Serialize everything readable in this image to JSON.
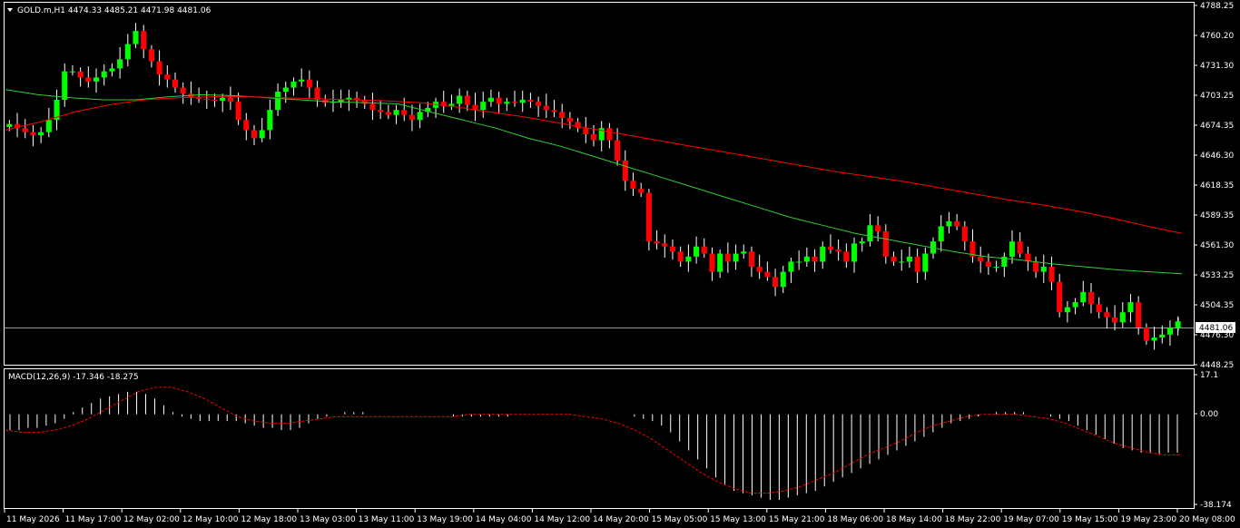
{
  "header": {
    "symbol_line": "GOLD.m,H1  4474.33 4485.21 4471.98 4481.06"
  },
  "price_axis": {
    "ticks": [
      "4788.25",
      "4760.20",
      "4731.30",
      "4703.25",
      "4674.35",
      "4646.30",
      "4618.35",
      "4589.35",
      "4561.30",
      "4533.25",
      "4504.35",
      "4476.30",
      "4448.25"
    ],
    "current_price": "4481.06"
  },
  "macd": {
    "label": "MACD(12,26,9) -17.346 -18.275",
    "ticks": [
      "17.1",
      "0.00",
      "-38.174"
    ]
  },
  "time_axis": {
    "labels": [
      "11 May 2026",
      "11 May 17:00",
      "12 May 02:00",
      "12 May 10:00",
      "12 May 18:00",
      "13 May 03:00",
      "13 May 11:00",
      "13 May 19:00",
      "14 May 04:00",
      "14 May 12:00",
      "14 May 20:00",
      "15 May 05:00",
      "15 May 13:00",
      "15 May 21:00",
      "18 May 06:00",
      "18 May 14:00",
      "18 May 22:00",
      "19 May 07:00",
      "19 May 15:00",
      "19 May 23:00",
      "20 May 08:00"
    ]
  },
  "colors": {
    "background": "#000000",
    "up_candle": "#00ff00",
    "down_candle": "#ff0000",
    "ma_fast": "#32cd32",
    "ma_slow": "#ff0000",
    "macd_signal": "#ff0000",
    "grid": "#ffffff"
  },
  "chart_data": {
    "type": "candlestick",
    "title": "GOLD.m,H1",
    "ohlc_last": {
      "open": 4474.33,
      "high": 4485.21,
      "low": 4471.98,
      "close": 4481.06
    },
    "price_range": [
      4440.0,
      4795.0
    ],
    "close_series": [
      4676,
      4672,
      4668,
      4665,
      4668,
      4680,
      4700,
      4728,
      4728,
      4722,
      4718,
      4722,
      4728,
      4731,
      4740,
      4755,
      4768,
      4750,
      4738,
      4725,
      4720,
      4712,
      4706,
      4702,
      4701,
      4700,
      4699,
      4702,
      4698,
      4680,
      4670,
      4662,
      4670,
      4690,
      4708,
      4712,
      4718,
      4720,
      4712,
      4700,
      4697,
      4698,
      4700,
      4702,
      4700,
      4696,
      4690,
      4688,
      4685,
      4690,
      4685,
      4680,
      4688,
      4692,
      4698,
      4694,
      4696,
      4704,
      4695,
      4690,
      4698,
      4702,
      4696,
      4698,
      4697,
      4700,
      4698,
      4694,
      4690,
      4688,
      4682,
      4678,
      4672,
      4666,
      4660,
      4672,
      4660,
      4640,
      4620,
      4612,
      4608,
      4560,
      4558,
      4555,
      4550,
      4540,
      4545,
      4555,
      4548,
      4530,
      4548,
      4540,
      4548,
      4550,
      4535,
      4530,
      4525,
      4515,
      4530,
      4540,
      4540,
      4545,
      4540,
      4555,
      4552,
      4550,
      4540,
      4558,
      4560,
      4576,
      4570,
      4545,
      4540,
      4540,
      4545,
      4530,
      4548,
      4560,
      4575,
      4580,
      4575,
      4560,
      4545,
      4540,
      4535,
      4535,
      4545,
      4560,
      4548,
      4540,
      4530,
      4535,
      4520,
      4490,
      4495,
      4500,
      4510,
      4498,
      4490,
      4485,
      4480,
      4490,
      4500,
      4475,
      4462,
      4465,
      4468,
      4475,
      4481
    ],
    "ma_fast_series": [
      4710,
      4705,
      4702,
      4700,
      4700,
      4703,
      4705,
      4704,
      4702,
      4700,
      4698,
      4697,
      4696,
      4688,
      4680,
      4672,
      4662,
      4654,
      4644,
      4634,
      4624,
      4614,
      4604,
      4594,
      4584,
      4576,
      4568,
      4562,
      4556,
      4550,
      4545,
      4542,
      4538,
      4535,
      4532,
      4530,
      4528
    ],
    "ma_slow_series": [
      4670,
      4678,
      4688,
      4695,
      4700,
      4702,
      4703,
      4703,
      4702,
      4701,
      4700,
      4699,
      4697,
      4693,
      4688,
      4683,
      4677,
      4671,
      4665,
      4659,
      4653,
      4647,
      4641,
      4635,
      4629,
      4624,
      4619,
      4613,
      4607,
      4601,
      4596,
      4590,
      4583,
      4575,
      4568
    ],
    "macd_range": [
      -40,
      18
    ],
    "macd_histogram": [
      -7,
      -7,
      -6,
      -6,
      -5,
      -4,
      -2,
      1,
      3,
      5,
      7,
      8,
      9,
      10,
      10,
      9,
      7,
      4,
      1,
      -1,
      -2,
      -3,
      -3,
      -3,
      -3,
      -3,
      -4,
      -5,
      -6,
      -6,
      -7,
      -7,
      -6,
      -4,
      -2,
      -1,
      0,
      1,
      1,
      1,
      0,
      0,
      0,
      0,
      0,
      0,
      0,
      0,
      0,
      -1,
      -1,
      -1,
      -1,
      -1,
      -1,
      -1,
      0,
      0,
      0,
      0,
      0,
      0,
      0,
      0,
      0,
      0,
      0,
      0,
      0,
      -1,
      -2,
      -3,
      -5,
      -8,
      -12,
      -16,
      -20,
      -24,
      -28,
      -31,
      -34,
      -35,
      -36,
      -37,
      -38,
      -38,
      -37,
      -36,
      -35,
      -34,
      -32,
      -30,
      -28,
      -26,
      -24,
      -22,
      -20,
      -18,
      -16,
      -14,
      -12,
      -10,
      -8,
      -6,
      -4,
      -3,
      -2,
      -1,
      0,
      1,
      1,
      1,
      1,
      0,
      0,
      -1,
      -2,
      -3,
      -5,
      -7,
      -9,
      -11,
      -13,
      -15,
      -16,
      -17,
      -17,
      -18,
      -17,
      -17
    ],
    "macd_signal_series": [
      -7,
      -8,
      -8,
      -7,
      -5,
      -2,
      2,
      6,
      10,
      12,
      12,
      10,
      7,
      3,
      -1,
      -3,
      -4,
      -4,
      -3,
      -2,
      -1,
      -1,
      -1,
      -1,
      -1,
      -1,
      -1,
      -1,
      0,
      0,
      0,
      0,
      0,
      0,
      0,
      -1,
      -2,
      -4,
      -7,
      -11,
      -16,
      -21,
      -26,
      -30,
      -33,
      -35,
      -35,
      -34,
      -32,
      -29,
      -26,
      -22,
      -18,
      -15,
      -12,
      -8,
      -5,
      -3,
      -1,
      0,
      0,
      0,
      -1,
      -2,
      -4,
      -7,
      -10,
      -13,
      -15,
      -17,
      -18,
      -18
    ]
  }
}
